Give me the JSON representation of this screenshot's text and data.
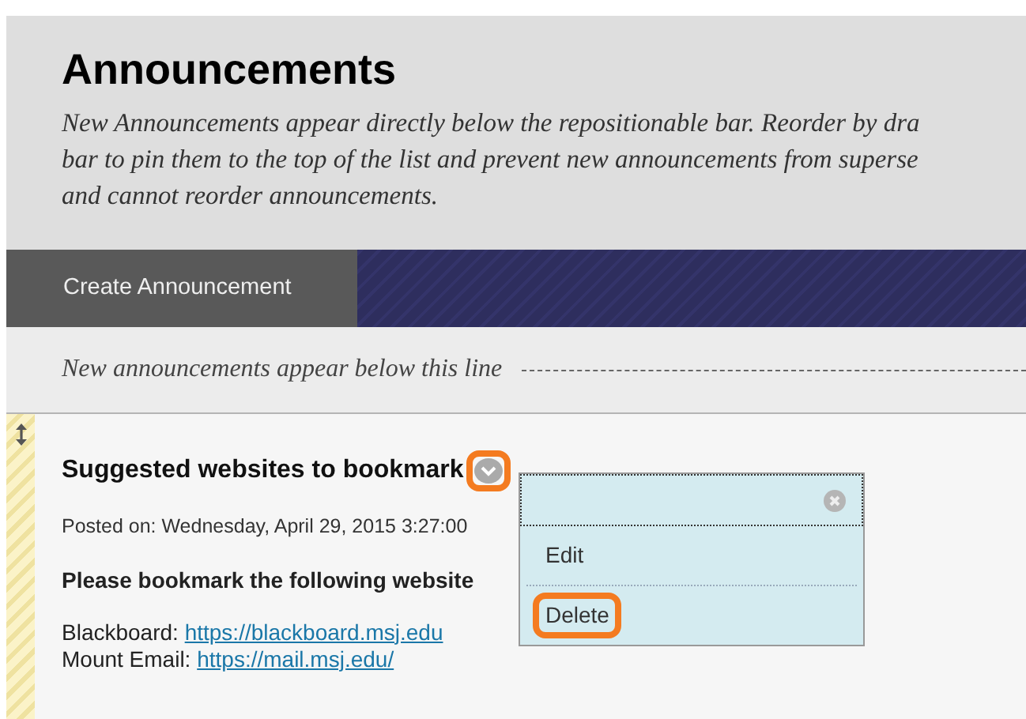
{
  "header": {
    "title": "Announcements",
    "description_lines": [
      "New Announcements appear directly below the repositionable bar. Reorder by dra",
      "bar to pin them to the top of the list and prevent new announcements from superse",
      "and cannot reorder announcements."
    ]
  },
  "action_bar": {
    "buttons": [
      {
        "label": "Create Announcement"
      }
    ]
  },
  "divider_line": {
    "text": "New announcements appear below this line"
  },
  "announcements": [
    {
      "title": "Suggested websites to bookmark",
      "menu_button_highlighted": true,
      "posted": "Posted on: Wednesday, April 29, 2015 3:27:00",
      "body": "Please bookmark the following website",
      "links": [
        {
          "label": "Blackboard:",
          "url": "https://blackboard.msj.edu"
        },
        {
          "label": "Mount Email:",
          "url": "https://mail.msj.edu/"
        }
      ]
    }
  ],
  "context_menu": {
    "items": [
      {
        "label": "Edit",
        "highlighted": false
      },
      {
        "label": "Delete",
        "highlighted": true
      }
    ]
  }
}
